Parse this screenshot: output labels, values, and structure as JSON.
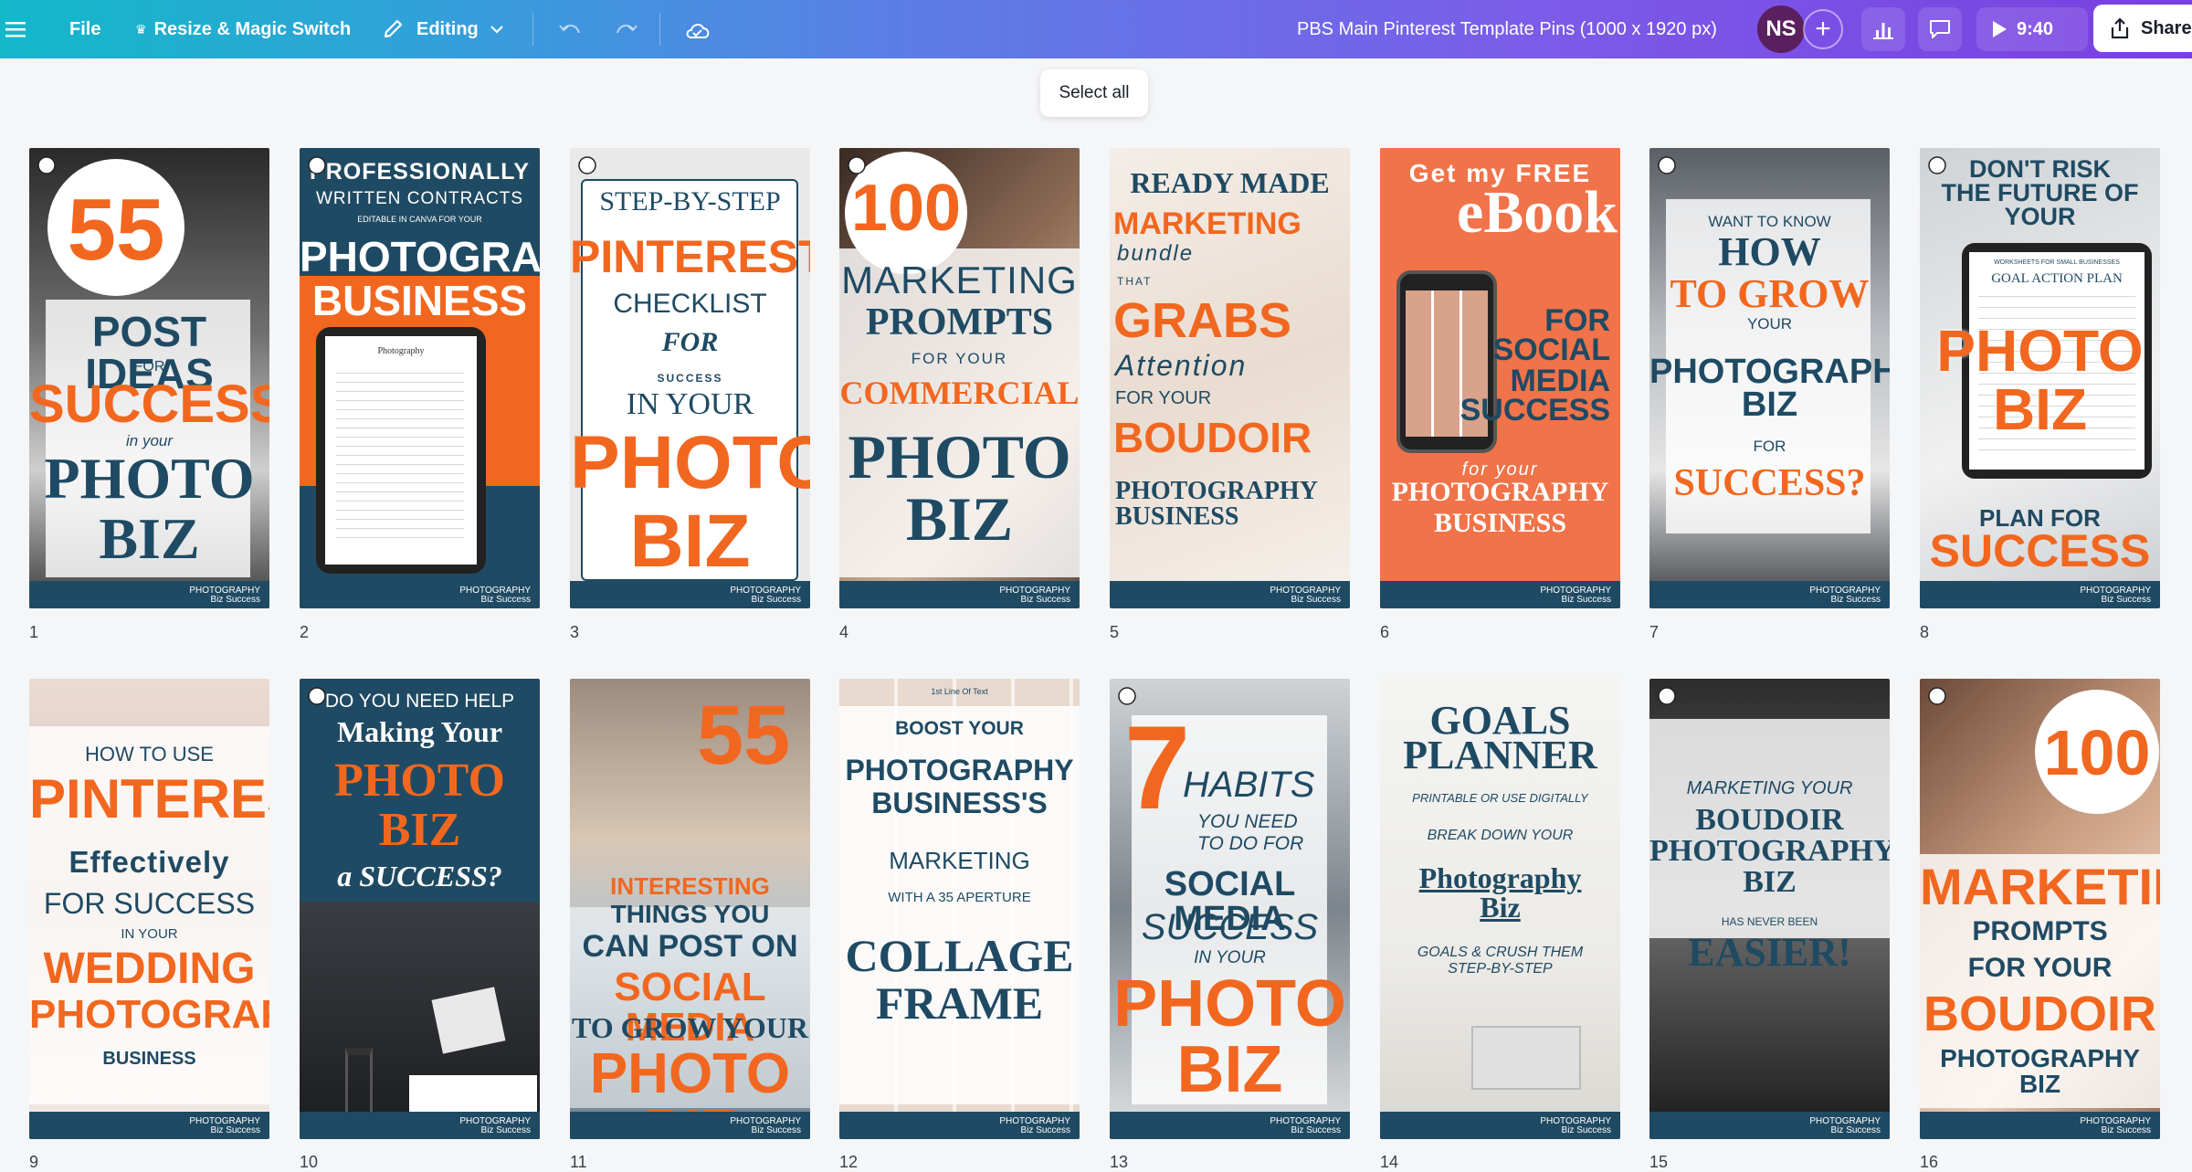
{
  "toolbar": {
    "menu_icon": "hamburger-icon",
    "file_label": "File",
    "resize_label": "Resize & Magic Switch",
    "editing_label": "Editing",
    "doc_title": "PBS Main Pinterest Template Pins (1000 x 1920 px)",
    "avatar_initials": "NS",
    "add_icon": "+",
    "present_time": "9:40",
    "share_label": "Share"
  },
  "select_all_label": "Select all",
  "colors": {
    "navy": "#1f4a63",
    "orange": "#f2671f",
    "accent_gradient_start": "#13b8c9",
    "accent_gradient_end": "#7a3fe0"
  },
  "logo": {
    "line1": "PHOTOGRAPHY",
    "line2": "Biz Success"
  },
  "pages": [
    {
      "num": "1",
      "lines": [
        "55",
        "POST IDEAS",
        "FOR",
        "SUCCESS",
        "in your",
        "PHOTO",
        "BIZ"
      ]
    },
    {
      "num": "2",
      "lines": [
        "PROFESSIONALLY",
        "WRITTEN CONTRACTS",
        "EDITABLE IN CANVA FOR YOUR",
        "PHOTOGRAPHY",
        "BUSINESS",
        "Photography"
      ]
    },
    {
      "num": "3",
      "lines": [
        "STEP-BY-STEP",
        "PINTEREST",
        "CHECKLIST",
        "FOR",
        "SUCCESS",
        "IN YOUR",
        "PHOTO",
        "BIZ"
      ]
    },
    {
      "num": "4",
      "lines": [
        "100",
        "MARKETING",
        "PROMPTS",
        "FOR YOUR",
        "COMMERCIAL",
        "PHOTO",
        "BIZ"
      ]
    },
    {
      "num": "5",
      "lines": [
        "READY MADE",
        "MARKETING",
        "bundle",
        "THAT",
        "GRABS",
        "Attention",
        "FOR YOUR",
        "BOUDOIR",
        "PHOTOGRAPHY",
        "BUSINESS"
      ]
    },
    {
      "num": "6",
      "lines": [
        "Get my FREE",
        "eBook",
        "FOR",
        "SOCIAL",
        "MEDIA",
        "SUCCESS",
        "for your",
        "PHOTOGRAPHY",
        "BUSINESS"
      ]
    },
    {
      "num": "7",
      "lines": [
        "WANT TO KNOW",
        "HOW",
        "TO GROW",
        "YOUR",
        "PHOTOGRAPHY",
        "BIZ",
        "FOR",
        "SUCCESS?"
      ]
    },
    {
      "num": "8",
      "lines": [
        "DON'T RISK",
        "THE FUTURE OF",
        "YOUR",
        "WORKSHEETS FOR SMALL BUSINESSES",
        "GOAL ACTION PLAN",
        "PHOTO",
        "BIZ",
        "PLAN FOR",
        "SUCCESS"
      ]
    },
    {
      "num": "9",
      "lines": [
        "HOW TO USE",
        "PINTEREST",
        "Effectively",
        "FOR SUCCESS",
        "IN YOUR",
        "WEDDING",
        "PHOTOGRAPHY",
        "BUSINESS"
      ]
    },
    {
      "num": "10",
      "lines": [
        "DO YOU NEED HELP",
        "Making Your",
        "PHOTO",
        "BIZ",
        "a SUCCESS?"
      ]
    },
    {
      "num": "11",
      "lines": [
        "55",
        "INTERESTING",
        "THINGS YOU",
        "CAN POST ON",
        "SOCIAL MEDIA",
        "TO GROW YOUR",
        "PHOTO BIZ"
      ]
    },
    {
      "num": "12",
      "lines": [
        "1st Line Of Text",
        "BOOST YOUR",
        "PHOTOGRAPHY",
        "BUSINESS'S",
        "MARKETING",
        "WITH A 35 APERTURE",
        "COLLAGE",
        "FRAME"
      ]
    },
    {
      "num": "13",
      "lines": [
        "7",
        "HABITS",
        "YOU NEED",
        "TO DO FOR",
        "SOCIAL MEDIA",
        "SUCCESS",
        "IN YOUR",
        "PHOTO",
        "BIZ"
      ]
    },
    {
      "num": "14",
      "lines": [
        "GOALS",
        "PLANNER",
        "PRINTABLE OR USE DIGITALLY",
        "BREAK DOWN YOUR",
        "Photography",
        "Biz",
        "GOALS & CRUSH THEM",
        "STEP-BY-STEP"
      ]
    },
    {
      "num": "15",
      "lines": [
        "MARKETING YOUR",
        "BOUDOIR",
        "PHOTOGRAPHY",
        "BIZ",
        "HAS NEVER BEEN",
        "EASIER!"
      ]
    },
    {
      "num": "16",
      "lines": [
        "100",
        "MARKETING",
        "PROMPTS",
        "FOR YOUR",
        "BOUDOIR",
        "PHOTOGRAPHY",
        "BIZ"
      ]
    }
  ]
}
